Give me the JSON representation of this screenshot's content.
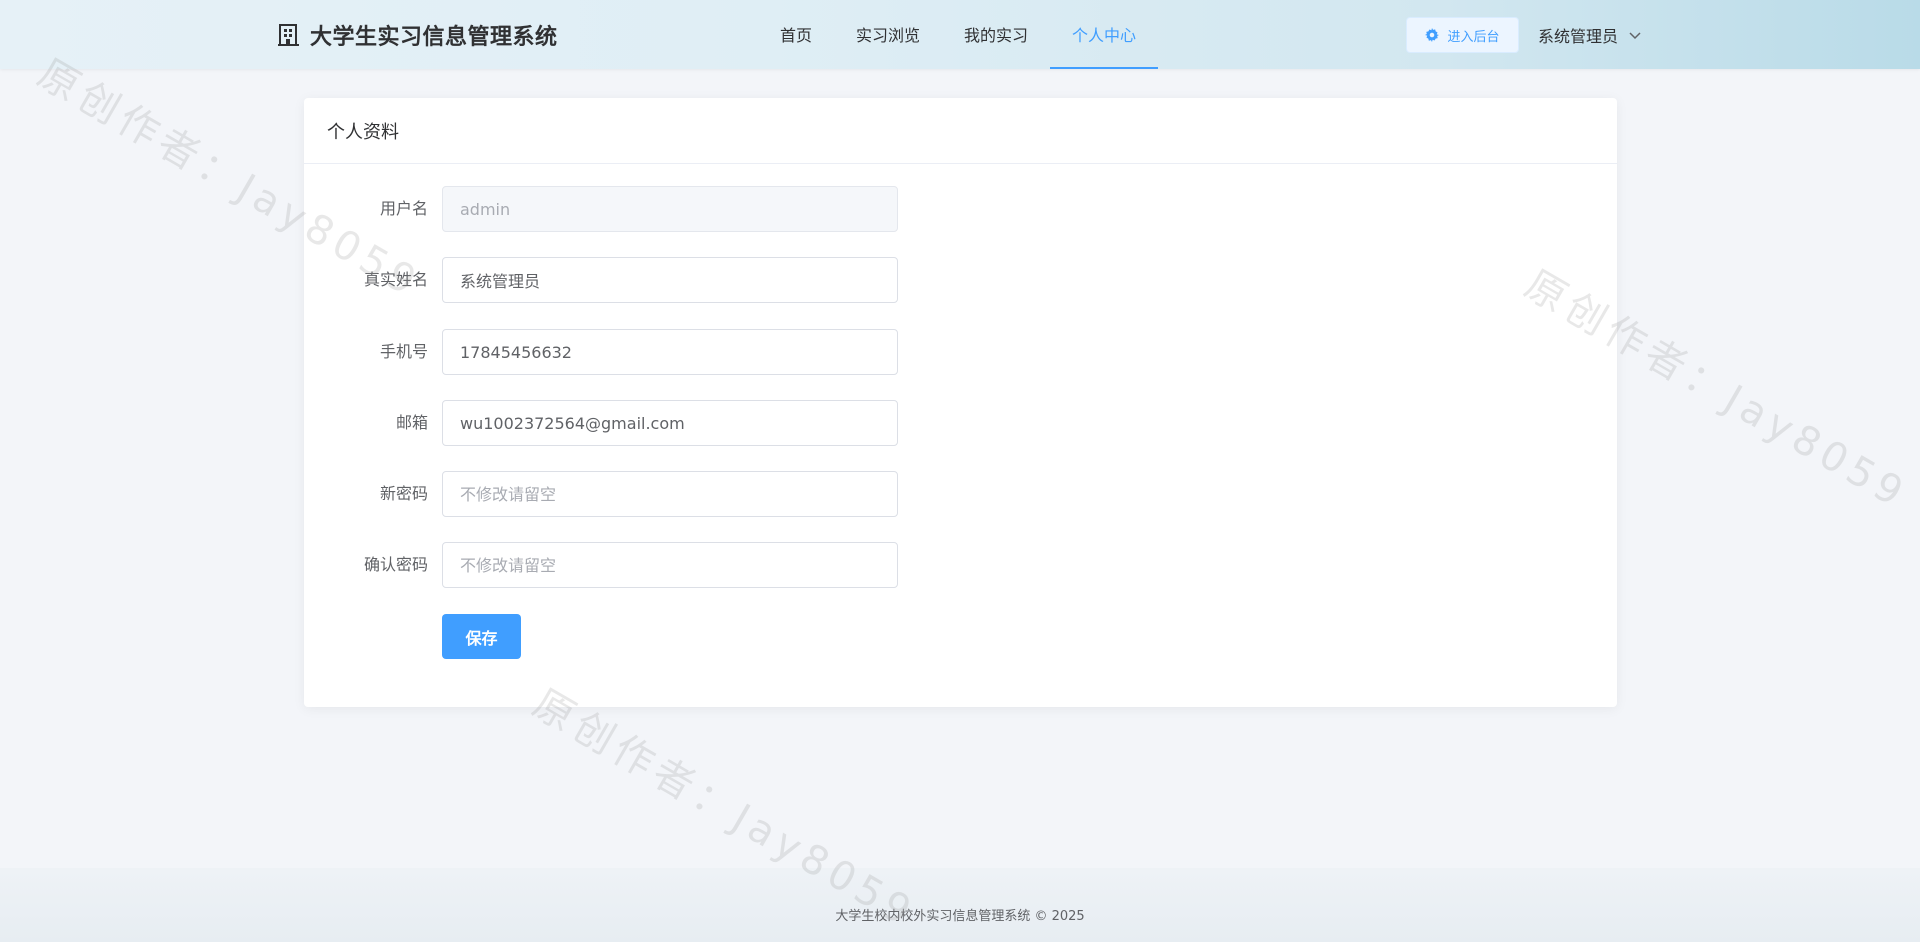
{
  "header": {
    "brand_title": "大学生实习信息管理系统",
    "nav": [
      {
        "label": "首页",
        "active": false
      },
      {
        "label": "实习浏览",
        "active": false
      },
      {
        "label": "我的实习",
        "active": false
      },
      {
        "label": "个人中心",
        "active": true
      }
    ],
    "admin_button_label": "进入后台",
    "user_name": "系统管理员"
  },
  "card": {
    "title": "个人资料",
    "fields": {
      "username": {
        "label": "用户名",
        "value": "admin",
        "disabled": true
      },
      "real_name": {
        "label": "真实姓名",
        "value": "系统管理员"
      },
      "phone": {
        "label": "手机号",
        "value": "17845456632"
      },
      "email": {
        "label": "邮箱",
        "value": "wu1002372564@gmail.com"
      },
      "new_password": {
        "label": "新密码",
        "value": "",
        "placeholder": "不修改请留空"
      },
      "confirm_password": {
        "label": "确认密码",
        "value": "",
        "placeholder": "不修改请留空"
      }
    },
    "save_label": "保存"
  },
  "footer": {
    "text": "大学生校内校外实习信息管理系统 © 2025"
  },
  "watermark": {
    "text": "原创作者：Jay8059"
  },
  "colors": {
    "primary": "#409eff",
    "text": "#303133",
    "label": "#606266",
    "placeholder": "#a8abb2"
  }
}
